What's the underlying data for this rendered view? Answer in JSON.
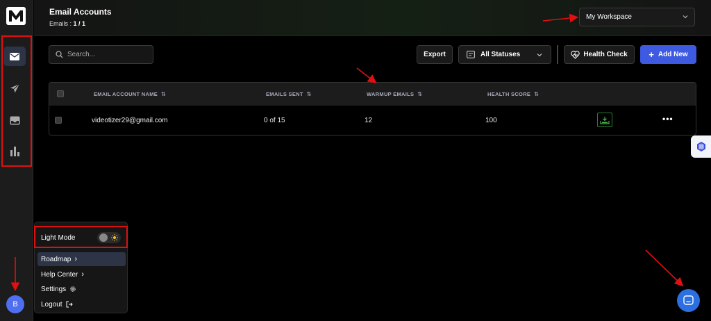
{
  "header": {
    "title": "Email Accounts",
    "count_label": "Emails :",
    "count_value": "1 / 1",
    "workspace": "My Workspace"
  },
  "toolbar": {
    "search_placeholder": "Search...",
    "export_label": "Export",
    "status_label": "All Statuses",
    "health_label": "Health Check",
    "add_label": "Add New"
  },
  "table": {
    "columns": [
      "EMAIL ACCOUNT NAME",
      "EMAILS SENT",
      "WARMUP EMAILS",
      "HEALTH SCORE"
    ],
    "rows": [
      {
        "email": "videotizer29@gmail.com",
        "sent": "0 of 15",
        "warmup": "12",
        "health": "100"
      }
    ]
  },
  "menu": {
    "light_mode": "Light Mode",
    "items": [
      "Roadmap",
      "Help Center",
      "Settings",
      "Logout"
    ]
  },
  "user": {
    "initial": "B"
  },
  "colors": {
    "accent": "#3d5ae0",
    "annotation": "#e01010",
    "chat": "#2b6fe0",
    "health_ok": "#2e7d32"
  },
  "icons": {
    "nav": [
      "mail-icon",
      "send-icon",
      "inbox-icon",
      "analytics-icon"
    ],
    "widget": "hexagon-grid-icon",
    "chat": "chat-icon"
  }
}
